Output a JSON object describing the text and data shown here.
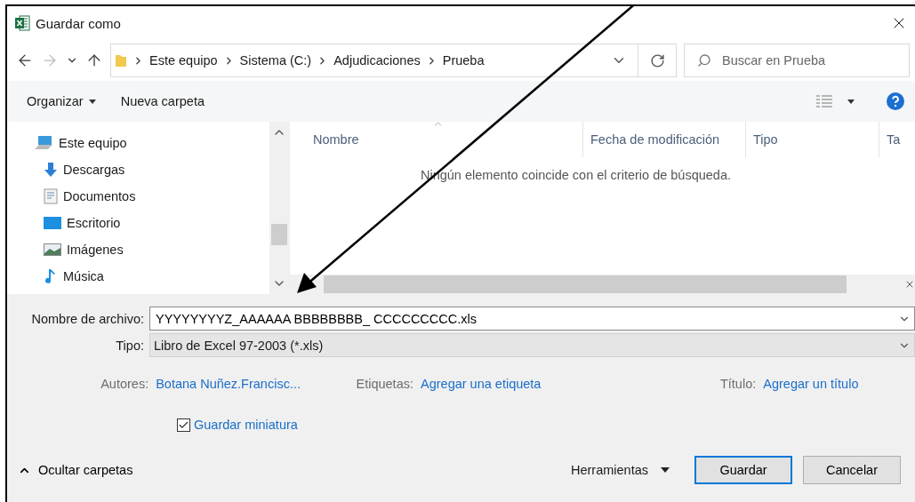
{
  "window": {
    "title": "Guardar como"
  },
  "address": {
    "path": [
      "Este equipo",
      "Sistema (C:)",
      "Adjudicaciones",
      "Prueba"
    ],
    "search_placeholder": "Buscar en Prueba"
  },
  "toolbar": {
    "organize": "Organizar",
    "new_folder": "Nueva carpeta"
  },
  "nav": [
    {
      "label": "Este equipo",
      "children": [
        {
          "label": "Descargas"
        },
        {
          "label": "Documentos"
        },
        {
          "label": "Escritorio"
        },
        {
          "label": "Imágenes"
        },
        {
          "label": "Música"
        }
      ]
    }
  ],
  "columns": [
    {
      "label": "Nombre",
      "sorted": true
    },
    {
      "label": "Fecha de modificación",
      "sorted": false
    },
    {
      "label": "Tipo",
      "sorted": false
    },
    {
      "label": "Ta",
      "sorted": false
    }
  ],
  "empty_message": "Ningún elemento coincide con el criterio de búsqueda.",
  "form": {
    "file_name_label": "Nombre de archivo:",
    "file_name": "YYYYYYYYZ_AAAAAA BBBBBBBB_ CCCCCCCCC.xls",
    "type_label": "Tipo:",
    "type": "Libro de Excel 97-2003 (*.xls)",
    "meta": [
      {
        "label": "Autores:",
        "value": "Botana Nuñez.Francisc..."
      },
      {
        "label": "Etiquetas:",
        "value": "Agregar una etiqueta"
      },
      {
        "label": "Título:",
        "value": "Agregar un título"
      }
    ],
    "thumbnail": {
      "label": "Guardar miniatura",
      "checked": true
    }
  },
  "footer": {
    "hide_folders": "Ocultar carpetas",
    "tools": "Herramientas",
    "buttons": [
      {
        "label": "Guardar",
        "default": true
      },
      {
        "label": "Cancelar",
        "default": false
      }
    ]
  }
}
